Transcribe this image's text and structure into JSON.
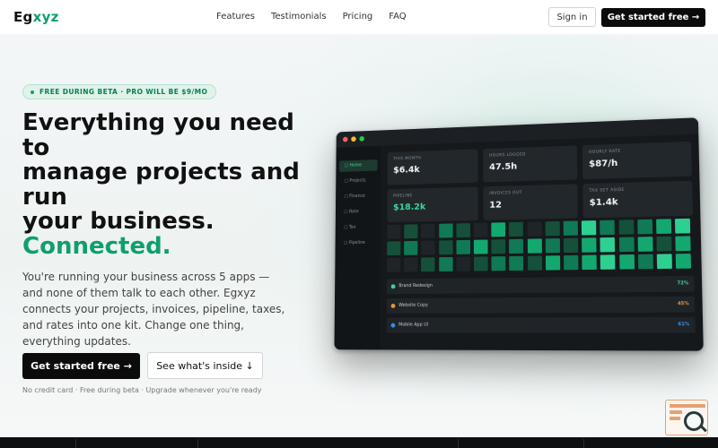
{
  "nav": {
    "logo_main": "Eg",
    "logo_accent": "xyz",
    "links": [
      "Features",
      "Testimonials",
      "Pricing",
      "FAQ"
    ],
    "signin_label": "Sign in",
    "cta_label": "Get started free →"
  },
  "hero": {
    "badge": "FREE DURING BETA · PRO WILL BE $9/MO",
    "headline_lines": [
      "Everything you need",
      "to",
      "manage projects and",
      "run",
      "your business."
    ],
    "headline_accent": "Connected.",
    "subtext": "You're running your business across 5 apps — and none of them talk to each other. Egxyz connects your projects, invoices, pipeline, taxes, and rates into one kit. Change one thing, everything updates.",
    "primary_cta": "Get started free →",
    "secondary_cta": "See what's inside ↓",
    "fineprint": "No credit card · Free during beta · Upgrade whenever you're ready"
  },
  "dashboard": {
    "sidebar": [
      "Home",
      "Projects",
      "Finance",
      "Rate",
      "Tax",
      "Pipeline"
    ],
    "active_sidebar": "Home",
    "cards": [
      {
        "label": "THIS MONTH",
        "value": "$6.4k",
        "highlight": false
      },
      {
        "label": "HOURS LOGGED",
        "value": "47.5h",
        "highlight": false
      },
      {
        "label": "HOURLY RATE",
        "value": "$87/h",
        "highlight": false
      },
      {
        "label": "PIPELINE",
        "value": "$18.2k",
        "highlight": true
      },
      {
        "label": "INVOICES OUT",
        "value": "12",
        "highlight": false
      },
      {
        "label": "TAX SET ASIDE",
        "value": "$1.4k",
        "highlight": false
      }
    ],
    "heatmap_levels": [
      [
        0,
        1,
        0,
        2,
        1,
        0,
        3,
        1,
        0,
        1,
        2,
        4,
        2,
        1,
        2,
        3,
        4
      ],
      [
        1,
        2,
        0,
        1,
        2,
        3,
        1,
        2,
        3,
        2,
        1,
        3,
        4,
        2,
        3,
        1,
        3
      ],
      [
        0,
        0,
        1,
        2,
        0,
        1,
        2,
        2,
        1,
        3,
        2,
        3,
        4,
        3,
        2,
        4,
        3
      ]
    ],
    "projects": [
      {
        "name": "Brand Redesign",
        "percent": "72%",
        "color": "#3fd69a"
      },
      {
        "name": "Website Copy",
        "percent": "45%",
        "color": "#e8963a"
      },
      {
        "name": "Mobile App UI",
        "percent": "61%",
        "color": "#3a8fe8"
      }
    ],
    "traffic_lights": [
      "#ff5f57",
      "#febc2e",
      "#28c840"
    ],
    "heat_colors": [
      "#1f2428",
      "#14503a",
      "#0f7a55",
      "#13a870",
      "#2ed092"
    ]
  },
  "colors": {
    "brand_green": "#0f9f6e",
    "cta_black": "#0b0b0b"
  }
}
